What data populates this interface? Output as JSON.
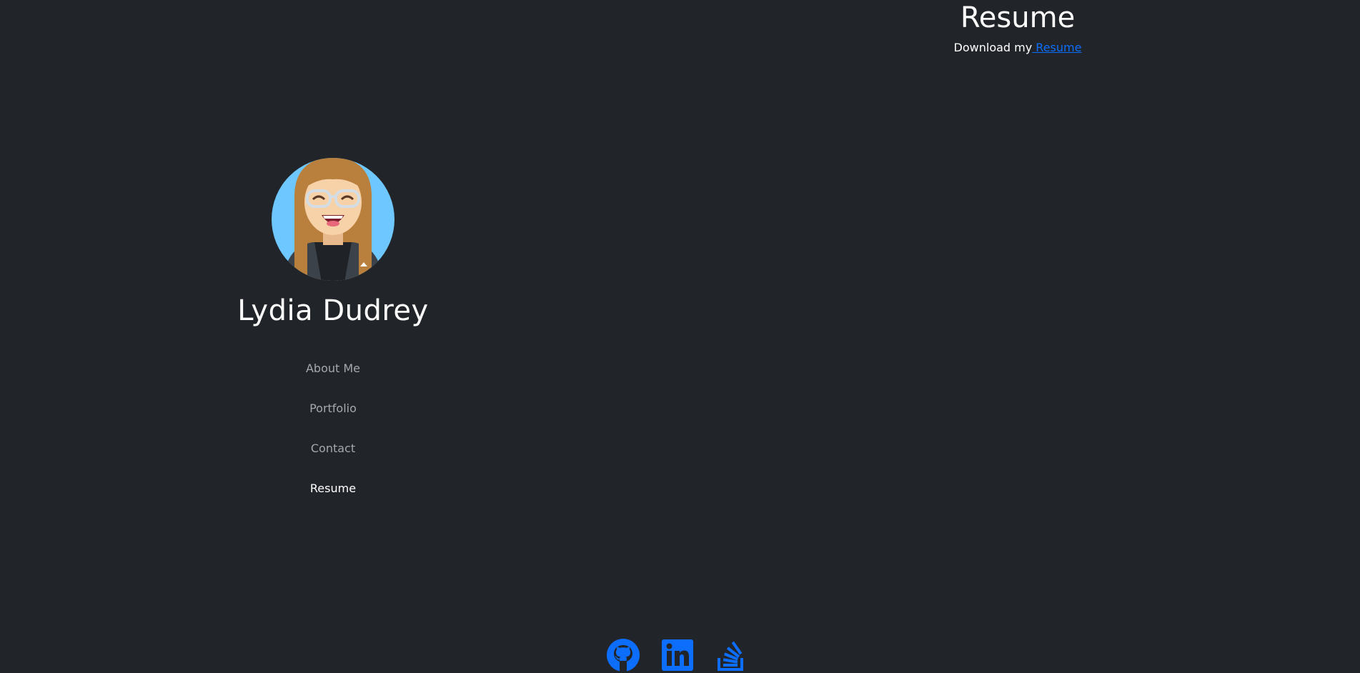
{
  "sidebar": {
    "name": "Lydia Dudrey",
    "nav": [
      {
        "label": "About Me",
        "active": false
      },
      {
        "label": "Portfolio",
        "active": false
      },
      {
        "label": "Contact",
        "active": false
      },
      {
        "label": "Resume",
        "active": true
      }
    ]
  },
  "main": {
    "title": "Resume",
    "download_text": "Download my",
    "download_link": " Resume"
  },
  "footer": {
    "icons": [
      "github-icon",
      "linkedin-icon",
      "stackoverflow-icon"
    ],
    "accent": "#0d6efd"
  },
  "colors": {
    "background": "#212529",
    "nav_inactive": "#a5a8ab",
    "avatar_bg": "#6ec8ff",
    "link": "#0d6efd"
  }
}
